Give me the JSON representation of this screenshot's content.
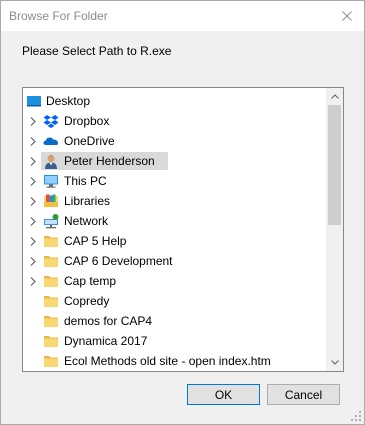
{
  "window": {
    "title": "Browse For Folder",
    "prompt": "Please Select Path to R.exe"
  },
  "tree": {
    "items": [
      {
        "label": "Desktop",
        "icon": "desktop-icon",
        "expander": false,
        "selected": false
      },
      {
        "label": "Dropbox",
        "icon": "dropbox-icon",
        "expander": true,
        "selected": false
      },
      {
        "label": "OneDrive",
        "icon": "onedrive-icon",
        "expander": true,
        "selected": false
      },
      {
        "label": "Peter Henderson",
        "icon": "user-folder-icon",
        "expander": true,
        "selected": true
      },
      {
        "label": "This PC",
        "icon": "computer-icon",
        "expander": true,
        "selected": false
      },
      {
        "label": "Libraries",
        "icon": "libraries-icon",
        "expander": true,
        "selected": false
      },
      {
        "label": "Network",
        "icon": "network-icon",
        "expander": true,
        "selected": false
      },
      {
        "label": "CAP 5 Help",
        "icon": "folder-icon",
        "expander": true,
        "selected": false
      },
      {
        "label": "CAP 6 Development",
        "icon": "folder-icon",
        "expander": true,
        "selected": false
      },
      {
        "label": "Cap temp",
        "icon": "folder-icon",
        "expander": true,
        "selected": false
      },
      {
        "label": "Copredy",
        "icon": "folder-icon",
        "expander": false,
        "selected": false
      },
      {
        "label": "demos for CAP4",
        "icon": "folder-icon",
        "expander": false,
        "selected": false
      },
      {
        "label": "Dynamica 2017",
        "icon": "folder-icon",
        "expander": false,
        "selected": false
      },
      {
        "label": "Ecol Methods old site - open index.htm",
        "icon": "folder-icon",
        "expander": false,
        "selected": false
      }
    ]
  },
  "buttons": {
    "ok": "OK",
    "cancel": "Cancel"
  },
  "colors": {
    "selection": "#d9d9d9",
    "folder": "#f8d775",
    "accent": "#0078d7"
  }
}
